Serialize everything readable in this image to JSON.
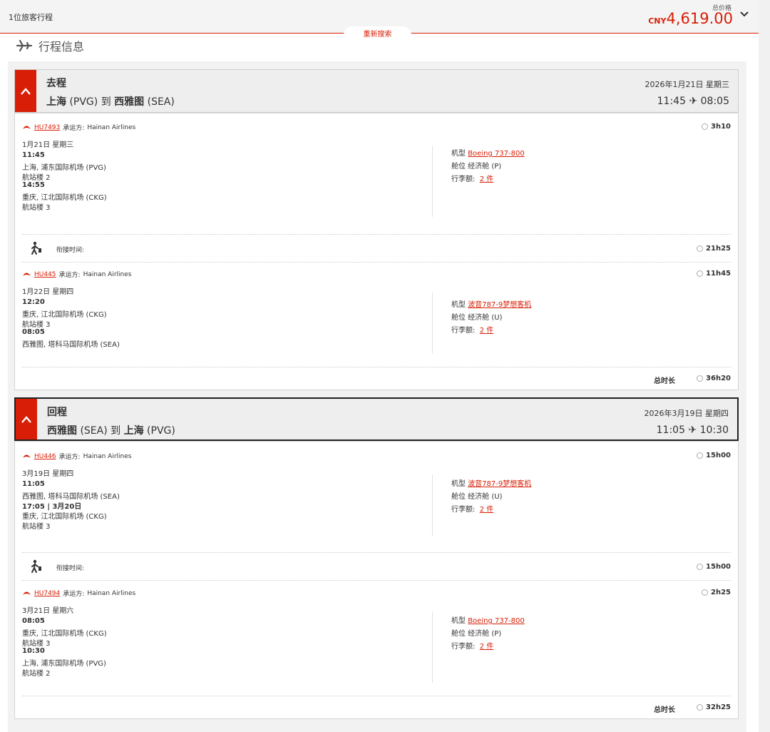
{
  "topbar": {
    "travelers": "1位旅客行程",
    "price_label": "总价格",
    "currency": "CNY",
    "amount": "4,619.00",
    "re_search": "重新搜索"
  },
  "section_title": "行程信息",
  "outbound": {
    "kind": "去程",
    "from_city": "上海",
    "from_code": "(PVG)",
    "to_word": "到",
    "to_city": "西雅图",
    "to_code": "(SEA)",
    "date": "2026年1月21日 星期三",
    "depart": "11:45",
    "arrive": "08:05",
    "segments": [
      {
        "flight_no": "HU7493",
        "carrier_label": "承运方:",
        "carrier": "Hainan Airlines",
        "duration": "3h10",
        "day": "1月21日 星期三",
        "dep_time": "11:45",
        "dep_airport": "上海, 浦东国际机场 (PVG)",
        "dep_terminal": "航站楼 2",
        "arr_time": "14:55",
        "arr_airport": "重庆, 江北国际机场 (CKG)",
        "arr_terminal": "航站楼 3",
        "aircraft_label": "机型",
        "aircraft": "Boeing 737-800",
        "cabin": "舱位 经济舱 (P)",
        "baggage_label": "行李额:",
        "baggage": "2 件"
      },
      {
        "flight_no": "HU445",
        "carrier_label": "承运方:",
        "carrier": "Hainan Airlines",
        "duration": "11h45",
        "day": "1月22日 星期四",
        "dep_time": "12:20",
        "dep_airport": "重庆, 江北国际机场 (CKG)",
        "dep_terminal": "航站楼 3",
        "arr_time": "08:05",
        "arr_airport": "西雅图, 塔科马国际机场 (SEA)",
        "aircraft_label": "机型",
        "aircraft": "波音787-9梦想客机",
        "cabin": "舱位 经济舱 (U)",
        "baggage_label": "行李额:",
        "baggage": "2 件"
      }
    ],
    "connection_label": "衔接时间:",
    "connection": "21h25",
    "total_label": "总时长",
    "total": "36h20"
  },
  "inbound": {
    "kind": "回程",
    "from_city": "西雅图",
    "from_code": "(SEA)",
    "to_word": "到",
    "to_city": "上海",
    "to_code": "(PVG)",
    "date": "2026年3月19日 星期四",
    "depart": "11:05",
    "arrive": "10:30",
    "segments": [
      {
        "flight_no": "HU446",
        "carrier_label": "承运方:",
        "carrier": "Hainan Airlines",
        "duration": "15h00",
        "day": "3月19日 星期四",
        "dep_time": "11:05",
        "dep_airport": "西雅图, 塔科马国际机场 (SEA)",
        "arr_time": "17:05 | 3月20日",
        "arr_airport": "重庆, 江北国际机场 (CKG)",
        "arr_terminal": "航站楼 3",
        "aircraft_label": "机型",
        "aircraft": "波音787-9梦想客机",
        "cabin": "舱位 经济舱 (U)",
        "baggage_label": "行李额:",
        "baggage": "2 件"
      },
      {
        "flight_no": "HU7494",
        "carrier_label": "承运方:",
        "carrier": "Hainan Airlines",
        "duration": "2h25",
        "day": "3月21日 星期六",
        "dep_time": "08:05",
        "dep_airport": "重庆, 江北国际机场 (CKG)",
        "dep_terminal": "航站楼 3",
        "arr_time": "10:30",
        "arr_airport": "上海, 浦东国际机场 (PVG)",
        "arr_terminal": "航站楼 2",
        "aircraft_label": "机型",
        "aircraft": "Boeing 737-800",
        "cabin": "舱位 经济舱 (P)",
        "baggage_label": "行李额:",
        "baggage": "2 件"
      }
    ],
    "connection_label": "衔接时间:",
    "connection": "15h00",
    "total_label": "总时长",
    "total": "32h25"
  },
  "colors": {
    "brand_red": "#d81e06"
  },
  "icons": [
    "plane-icon",
    "chevron-down-icon",
    "chevron-up-icon",
    "airline-logo-icon",
    "clock-icon",
    "walking-person-icon"
  ]
}
